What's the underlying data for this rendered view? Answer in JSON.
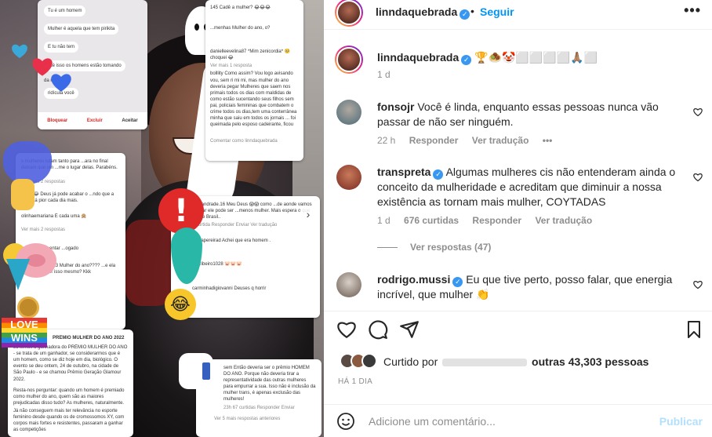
{
  "media": {
    "cards": {
      "c1": [
        "Tu é um homem",
        "Mulher é aquela que tem pirikita",
        "E tu não tem",
        "Até isso os homens estão tomando",
        "da mulher",
        "ridícula você"
      ],
      "c1_buttons": [
        "Bloquear",
        "Excluir",
        "Aceitar"
      ],
      "c2": [
        "145 Cadê a mulher? 😂😂😂",
        "...menhas Mulher do ano, o?",
        "danielleevelina87 *Mim zenicordia* 🥺 choquei 😂",
        "Ver mais 1 resposta",
        "bolllity Como assim? Vou logo avisando vou, sem ri mi mi, mas mulher do ano deveria pegar Mulheres que saem nos primais todos os dias com maldidas de como estão sucentando seus filhos sem pai, policiais femininas que combatem o crime todos os dias,tem uma conterrânea minha que saiu em todos os jornais ... foi queimada pelo esposo cadeirante, ficou",
        "Comentar como linndaquebrada"
      ],
      "c3": [
        "s mulheres lutam tanto para ...ara no final deixam que um ...me o lugar delas. Parabéns.",
        "Ver mais 2 respostas",
        "rre28 😂 Deus já pode acabar o ...ndo que a coisa tá pior cada dia mais.",
        "olinhaemariana É cada uma 🙊",
        "Ver mais 2 respostas",
        "vou nem comentar ...ogado",
        "drade.marques23 Mulher do ano???? ...e ela fez pra receber isso mesmo? Kkk"
      ],
      "c4": [
        "ana.andrade.16 Meu Deus 😱😱 como ...de aonde vamos chegar ele pode ser ...menos mulher. Mais espera o que ...este Brasil..",
        "1 curtida   Responder   Enviar   Ver tradução",
        "dinhapereirad Achei que era homem .",
        "ele.ribeiro1028 🐷🐷🐷",
        "carminhadigiovanni Deuses q horrir"
      ],
      "c5": [
        "PRÊMIO MULHER DO ANO 2022",
        "Já temos a ganhadora do PRÊMIO MULHER DO ANO - se trata de um ganhador, se considerarmos que é um homem, como se diz hoje em dia, biológico. O evento se deu ontem, 24 de outubro, na cidade de São Paulo - e se chamou Prêmio Geração Glamour 2022.",
        "Resta-nos perguntar: quando um homem é premiado como mulher do ano, quem são as maiores prejudicadas disso tudo? As mulheres, naturalmente.",
        "Já não conseguem mais ter relevância no esporte feminino desde quando os de cromossomos XY, com corpos mais fortes e resistentes, passaram a ganhar as competições"
      ],
      "c6": [
        "sem Então deveria ser o prêmio HOMEM DO ANO. Porque não deveria tirar a representatividade das outras mulheres para empurrar a sua. Isso não é inclusão da mulher trans, é apenas exclusão das mulheres!",
        "23h   67 curtidas   Responder   Enviar",
        "Ver 5 mais respostas anteriores"
      ]
    },
    "stickers": {
      "love_wins": [
        "LOVE",
        "WINS"
      ],
      "exclamation": "!",
      "laugh": "😂"
    },
    "next_arrow": "›"
  },
  "header": {
    "username": "linndaquebrada",
    "follow_label": "Seguir",
    "separator": "•",
    "more_label": "•••"
  },
  "caption": {
    "username": "linndaquebrada",
    "text": "🏆🧆🤡⬜⬜⬜⬜🙏🏽⬜",
    "time": "1 d"
  },
  "comments": [
    {
      "username": "fonsojr",
      "text": "Você é linda, enquanto essas pessoas nunca vão passar de não ser ninguém.",
      "time": "22 h",
      "reply": "Responder",
      "translate": "Ver tradução",
      "more": "•••"
    },
    {
      "username": "transpreta",
      "text": "Algumas mulheres cis não entenderam ainda o conceito da mulheridade e acreditam que diminuir a nossa existência as tornam mais mulher, COYTADAS",
      "time": "1 d",
      "likes": "676 curtidas",
      "reply": "Responder",
      "translate": "Ver tradução",
      "view_replies": "Ver respostas (47)"
    },
    {
      "username": "rodrigo.mussi",
      "text": "Eu que tive perto, posso falar, que energia incrível, que mulher 👏"
    }
  ],
  "liked_by": {
    "prefix": "Curtido por",
    "suffix": "outras 43,303 pessoas"
  },
  "timestamp": "HÁ 1 DIA",
  "add_comment": {
    "placeholder": "Adicione um comentário...",
    "publish": "Publicar"
  },
  "colors": {
    "link_blue": "#0095f6",
    "verified_blue": "#3897f0",
    "muted": "#8e8e8e",
    "publish_disabled": "#b2dffc"
  }
}
